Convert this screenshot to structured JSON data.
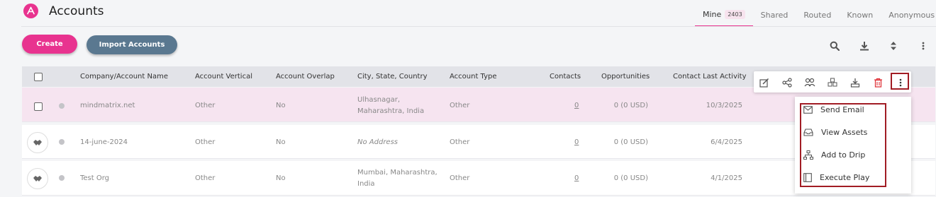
{
  "header": {
    "title": "Accounts"
  },
  "tabs": [
    {
      "label": "Mine",
      "badge": "2403"
    },
    {
      "label": "Shared"
    },
    {
      "label": "Routed"
    },
    {
      "label": "Known"
    },
    {
      "label": "Anonymous"
    }
  ],
  "actions": {
    "create": "Create",
    "import": "Import Accounts"
  },
  "table": {
    "columns": [
      "Company/Account Name",
      "Account Vertical",
      "Account Overlap",
      "City, State, Country",
      "Account Type",
      "Contacts",
      "Opportunities",
      "Contact Last Activity"
    ],
    "rows": [
      {
        "name": "mindmatrix.net",
        "vertical": "Other",
        "overlap": "No",
        "city1": "Ulhasnagar,",
        "city2": "Maharashtra, India",
        "type": "Other",
        "contacts": "0",
        "opps": "0 (0 USD)",
        "last": "10/3/2025"
      },
      {
        "name": "14-june-2024",
        "vertical": "Other",
        "overlap": "No",
        "city1": "No Address",
        "city2": "",
        "type": "Other",
        "contacts": "0",
        "opps": "0 (0 USD)",
        "last": "6/4/2025"
      },
      {
        "name": "Test Org",
        "vertical": "Other",
        "overlap": "No",
        "city1": "Mumbai, Maharashtra,",
        "city2": "India",
        "type": "Other",
        "contacts": "0",
        "opps": "0 (0 USD)",
        "last": "4/1/2025"
      }
    ]
  },
  "menu": [
    "Send Email",
    "View Assets",
    "Add to Drip",
    "Execute Play"
  ],
  "icons": [
    "logo-icon",
    "search-icon",
    "download-icon",
    "sort-icon",
    "more-vert-icon",
    "edit-icon",
    "share-icon",
    "users-icon",
    "cubes-icon",
    "export-icon",
    "trash-icon",
    "mail-icon",
    "inbox-icon",
    "sitemap-icon",
    "book-icon",
    "handshake-icon"
  ],
  "colors": {
    "accent": "#e8338f",
    "secondary": "#5a7890",
    "highlight_row": "#f6e4f0",
    "danger": "#e0383e"
  }
}
